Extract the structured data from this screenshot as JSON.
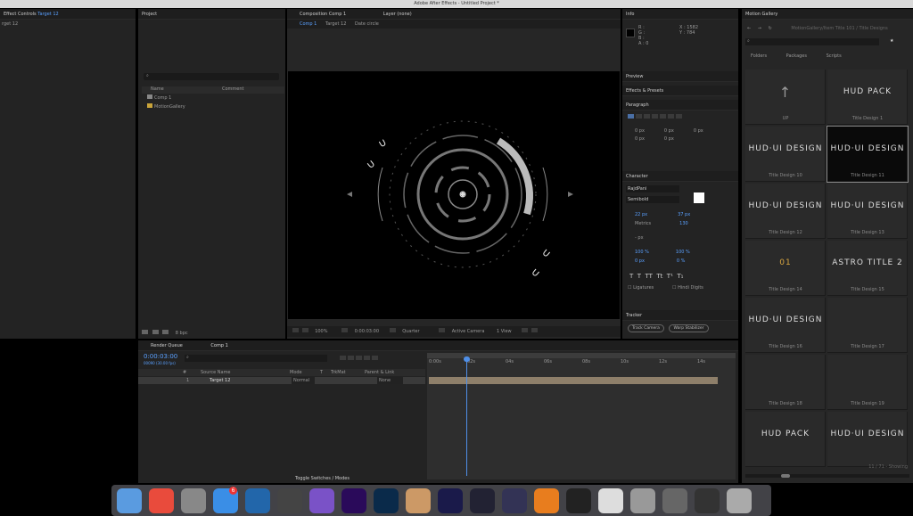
{
  "window": {
    "title": "Adobe After Effects - Untitled Project *"
  },
  "effect_controls": {
    "tab_prefix": "Effect Controls",
    "tab_layer": "Target 12",
    "layer_label": "rget 12"
  },
  "project": {
    "tab": "Project",
    "col_name": "Name",
    "col_comment": "Comment",
    "items": [
      {
        "name": "Comp 1"
      },
      {
        "name": "MotionGallery"
      }
    ],
    "bottom_depth": "8 bpc"
  },
  "composition": {
    "tab": "Composition Comp 1",
    "layer_tab": "Layer (none)",
    "breadcrumbs": [
      "Comp 1",
      "Target 12",
      "Date circle"
    ],
    "zoom": "100%",
    "timecode": "0:00:03:00",
    "resolution": "Quarter",
    "camera": "Active Camera",
    "view": "1 View"
  },
  "info": {
    "tab": "Info",
    "r": "R :",
    "g": "G :",
    "b": "B :",
    "a": "A : 0",
    "x": "X : 1582",
    "y": "Y : 784"
  },
  "preview": {
    "tab": "Preview"
  },
  "effects_presets": {
    "tab": "Effects & Presets"
  },
  "paragraph": {
    "tab": "Paragraph",
    "indent_left": "0 px",
    "indent_first": "0 px",
    "indent_right": "0 px",
    "space_before": "0 px",
    "space_after": "0 px"
  },
  "character": {
    "tab": "Character",
    "font": "RajdPani",
    "style": "Semibold",
    "size": "22 px",
    "leading": "37 px",
    "kerning": "Metrics",
    "tracking": "130",
    "stroke": "- px",
    "vscale": "100 %",
    "hscale": "100 %",
    "baseline": "0 px",
    "tsume": "0 %",
    "ligatures": "Ligatures",
    "hindi": "Hindi Digits"
  },
  "tracker": {
    "tab": "Tracker",
    "track_camera": "Track Camera",
    "warp": "Warp Stabilizer"
  },
  "motion_gallery": {
    "tab": "Motion Gallery",
    "search_path": "MotionGallery/Item Title 101 / Title Designs",
    "tabs": [
      "Folders",
      "Packages",
      "Scripts"
    ],
    "items": [
      {
        "preview": "↑",
        "caption": "UP"
      },
      {
        "preview": "HUD PACK",
        "caption": "Title Design 1"
      },
      {
        "preview": "HUD·UI DESIGN",
        "caption": "Title Design 10"
      },
      {
        "preview": "HUD·UI DESIGN",
        "caption": "Title Design 11"
      },
      {
        "preview": "HUD·UI DESIGN",
        "caption": "Title Design 12"
      },
      {
        "preview": "HUD·UI DESIGN",
        "caption": "Title Design 13"
      },
      {
        "preview": "01",
        "caption": "Title Design 14"
      },
      {
        "preview": "ASTRO TITLE 2",
        "caption": "Title Design 15"
      },
      {
        "preview": "HUD·UI DESIGN",
        "caption": "Title Design 16"
      },
      {
        "preview": "",
        "caption": "Title Design 17"
      },
      {
        "preview": "",
        "caption": "Title Design 18"
      },
      {
        "preview": "",
        "caption": "Title Design 19"
      },
      {
        "preview": "HUD PACK",
        "caption": ""
      },
      {
        "preview": "HUD·UI DESIGN",
        "caption": ""
      }
    ],
    "footer": "11 / 71 - Showing"
  },
  "timeline": {
    "tabs": [
      "Render Queue",
      "Comp 1"
    ],
    "timecode": "0:00:03:00",
    "frames": "00090 (30.00 fps)",
    "columns": [
      "#",
      "Source Name",
      "Mode",
      "T",
      "TrkMat",
      "Parent & Link"
    ],
    "layer": {
      "num": "1",
      "name": "Target 12",
      "mode": "Normal",
      "parent": "None"
    },
    "ruler": [
      "0:00s",
      "02s",
      "04s",
      "06s",
      "08s",
      "10s",
      "12s",
      "14s"
    ],
    "toggle": "Toggle Switches / Modes"
  },
  "dock": {
    "apps": [
      "Finder",
      "Chrome",
      "Launchpad",
      "App Store",
      "QuickTime",
      "Final Cut",
      "Motion",
      "Premiere",
      "Photoshop",
      "Photos",
      "After Effects",
      "DaVinci",
      "Instruments",
      "VLC",
      "OBS",
      "Preview",
      "Mail",
      "Screenshot",
      "Terminal",
      "Trash"
    ],
    "badge": "6"
  },
  "colors": {
    "accent": "#5aa0ff",
    "panel": "#232323",
    "hud_ring": "#7a7a7a",
    "hud_text": "#e8e8e8"
  }
}
